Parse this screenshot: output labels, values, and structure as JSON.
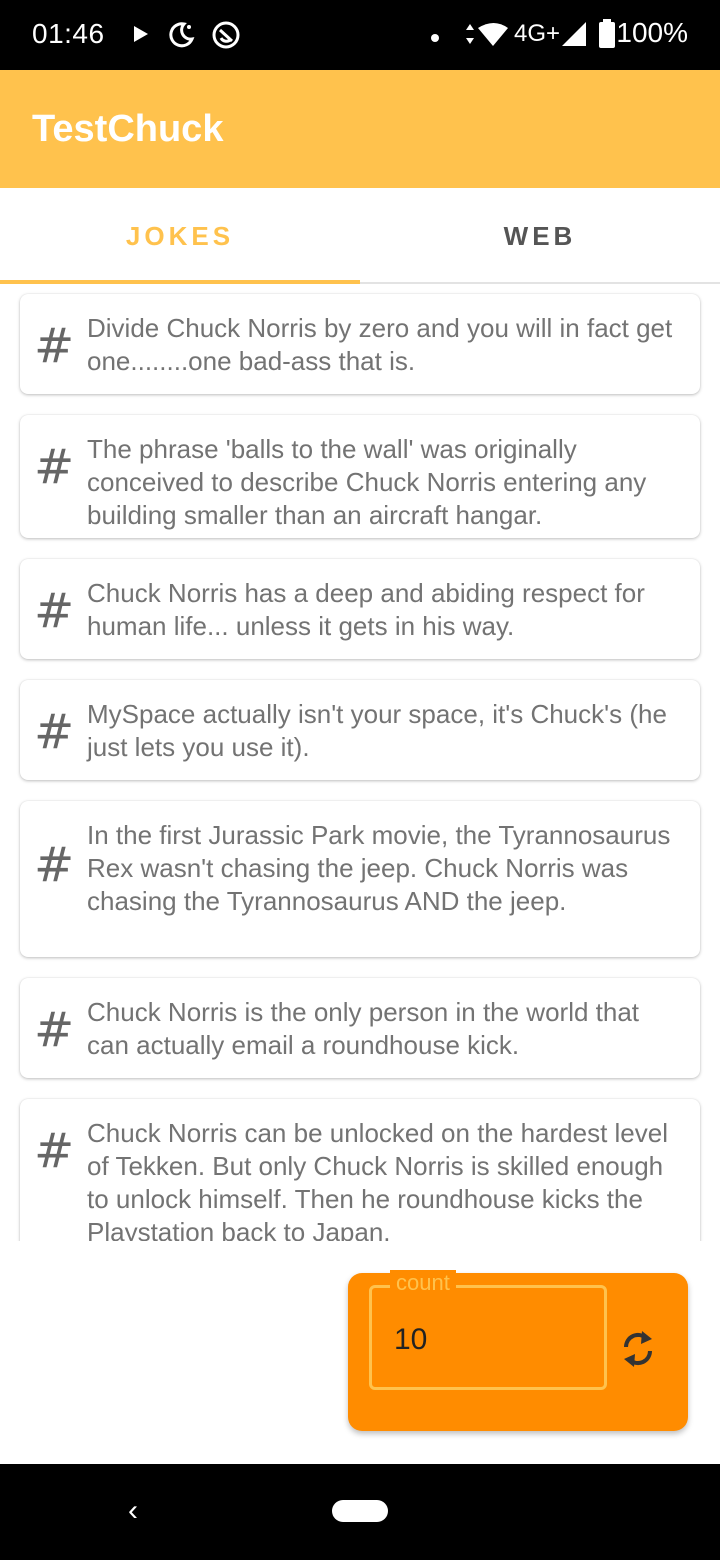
{
  "status_bar": {
    "time": "01:46",
    "network": "4G+",
    "battery": "100%",
    "icons": [
      "play-icon",
      "do-not-disturb-icon",
      "sync-icon",
      "dot-icon",
      "wifi-icon",
      "signal-icon",
      "battery-icon"
    ]
  },
  "app": {
    "title": "TestChuck",
    "accent_color": "#ffc24d",
    "panel_color": "#ff8c00"
  },
  "tabs": [
    {
      "label": "JOKES",
      "selected": true
    },
    {
      "label": "WEB",
      "selected": false
    }
  ],
  "jokes": [
    {
      "icon": "#",
      "text": "Divide Chuck Norris by zero and you will in fact get one........one bad-ass that is."
    },
    {
      "icon": "#",
      "text": "The phrase 'balls to the wall' was originally conceived to describe Chuck Norris entering any building smaller than an aircraft hangar."
    },
    {
      "icon": "#",
      "text": "Chuck Norris has a deep and abiding respect for human life... unless it gets in his way."
    },
    {
      "icon": "#",
      "text": "MySpace actually isn't your space, it's Chuck's (he just lets you use it)."
    },
    {
      "icon": "#",
      "text": "In the first Jurassic Park movie, the Tyrannosaurus Rex wasn't chasing the jeep. Chuck Norris was chasing the Tyrannosaurus AND the jeep."
    },
    {
      "icon": "#",
      "text": "Chuck Norris is the only person in the world that can actually email a roundhouse kick."
    },
    {
      "icon": "#",
      "text": "Chuck Norris can be unlocked on the hardest level of Tekken. But only Chuck Norris is skilled enough to unlock himself. Then he roundhouse kicks the Playstation back to Japan."
    }
  ],
  "count_field": {
    "label": "count",
    "value": "10"
  },
  "nav": {
    "back_glyph": "‹"
  }
}
